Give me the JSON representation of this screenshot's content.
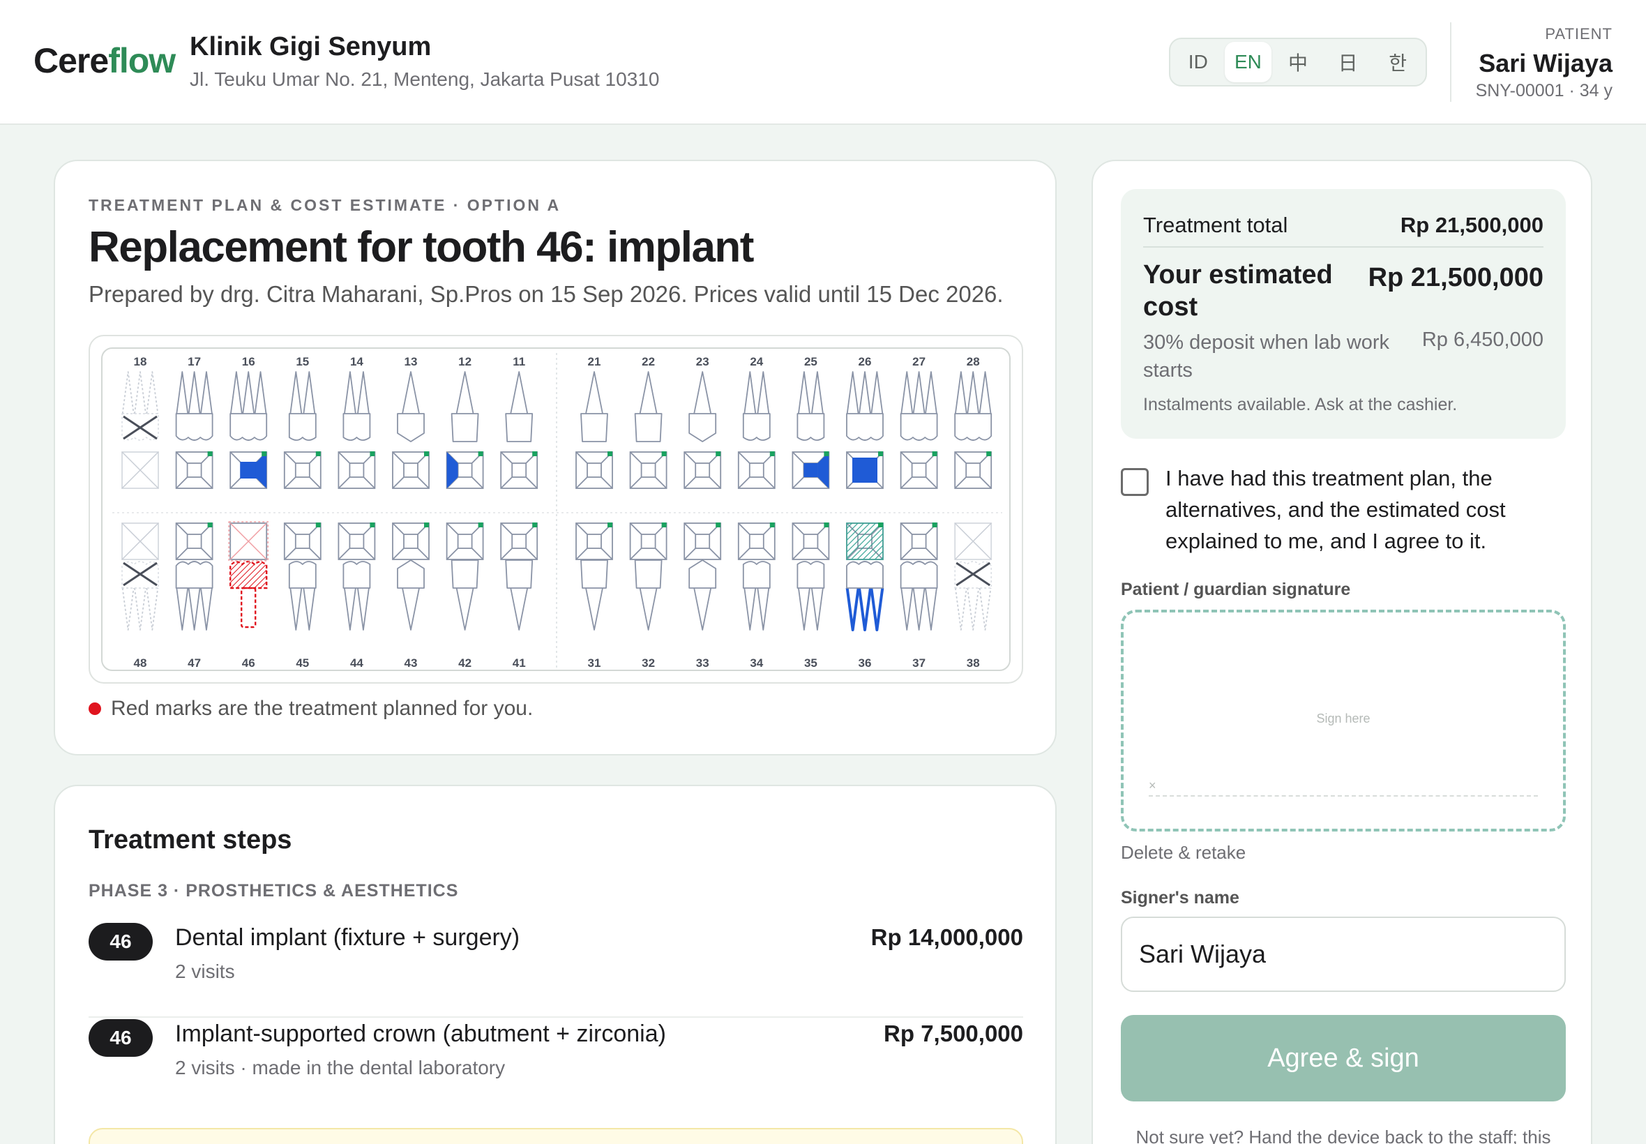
{
  "header": {
    "logo_main": "Cere",
    "logo_accent": "flow",
    "clinic_name": "Klinik Gigi Senyum",
    "clinic_address": "Jl. Teuku Umar No. 21, Menteng, Jakarta Pusat 10310",
    "languages": [
      "ID",
      "EN",
      "中",
      "日",
      "한"
    ],
    "active_language": "EN",
    "patient_label": "PATIENT",
    "patient_name": "Sari Wijaya",
    "patient_meta": "SNY-00001 · 34 y"
  },
  "plan": {
    "eyebrow": "TREATMENT PLAN & COST ESTIMATE · OPTION A",
    "title": "Replacement for tooth 46: implant",
    "subtitle": "Prepared by drg. Citra Maharani, Sp.Pros on 15 Sep 2026. Prices valid until 15 Dec 2026.",
    "legend_text": "Red marks are the treatment planned for you."
  },
  "tooth_chart": {
    "upper_teeth": [
      "18",
      "17",
      "16",
      "15",
      "14",
      "13",
      "12",
      "11",
      "21",
      "22",
      "23",
      "24",
      "25",
      "26",
      "27",
      "28"
    ],
    "lower_teeth": [
      "48",
      "47",
      "46",
      "45",
      "44",
      "43",
      "42",
      "41",
      "31",
      "32",
      "33",
      "34",
      "35",
      "36",
      "37",
      "38"
    ],
    "missing": [
      "18",
      "48",
      "38"
    ],
    "planned_treatment": [
      "46"
    ],
    "blue_fillings": [
      "16",
      "12",
      "25",
      "26"
    ],
    "root_canal": [
      "36"
    ],
    "teal_hatched": [
      "36"
    ],
    "colors": {
      "outline": "#8a93a6",
      "planned": "#e0141e",
      "filling": "#1f5bd6",
      "teal": "#3aa596",
      "marker": "#1aa260"
    }
  },
  "steps": {
    "title": "Treatment steps",
    "phase": "PHASE 3 · PROSTHETICS & AESTHETICS",
    "items": [
      {
        "tooth": "46",
        "name": "Dental implant (fixture + surgery)",
        "meta": "2 visits",
        "price": "Rp 14,000,000"
      },
      {
        "tooth": "46",
        "name": "Implant-supported crown (abutment + zirconia)",
        "meta": "2 visits · made in the dental laboratory",
        "price": "Rp 7,500,000"
      }
    ]
  },
  "summary": {
    "total_label": "Treatment total",
    "total_value": "Rp 21,500,000",
    "estimate_label": "Your estimated cost",
    "estimate_value": "Rp 21,500,000",
    "deposit_label": "30% deposit when lab work starts",
    "deposit_value": "Rp 6,450,000",
    "instalment_note": "Instalments available. Ask at the cashier."
  },
  "consent": {
    "checkbox_text": "I have had this treatment plan, the alternatives, and the estimated cost explained to me, and I agree to it.",
    "signature_label": "Patient / guardian signature",
    "signature_placeholder": "Sign here",
    "signature_x": "×",
    "retake_label": "Delete & retake",
    "signer_label": "Signer's name",
    "signer_value": "Sari Wijaya",
    "agree_button": "Agree & sign",
    "footer_note": "Not sure yet? Hand the device back to the staff; this plan"
  }
}
